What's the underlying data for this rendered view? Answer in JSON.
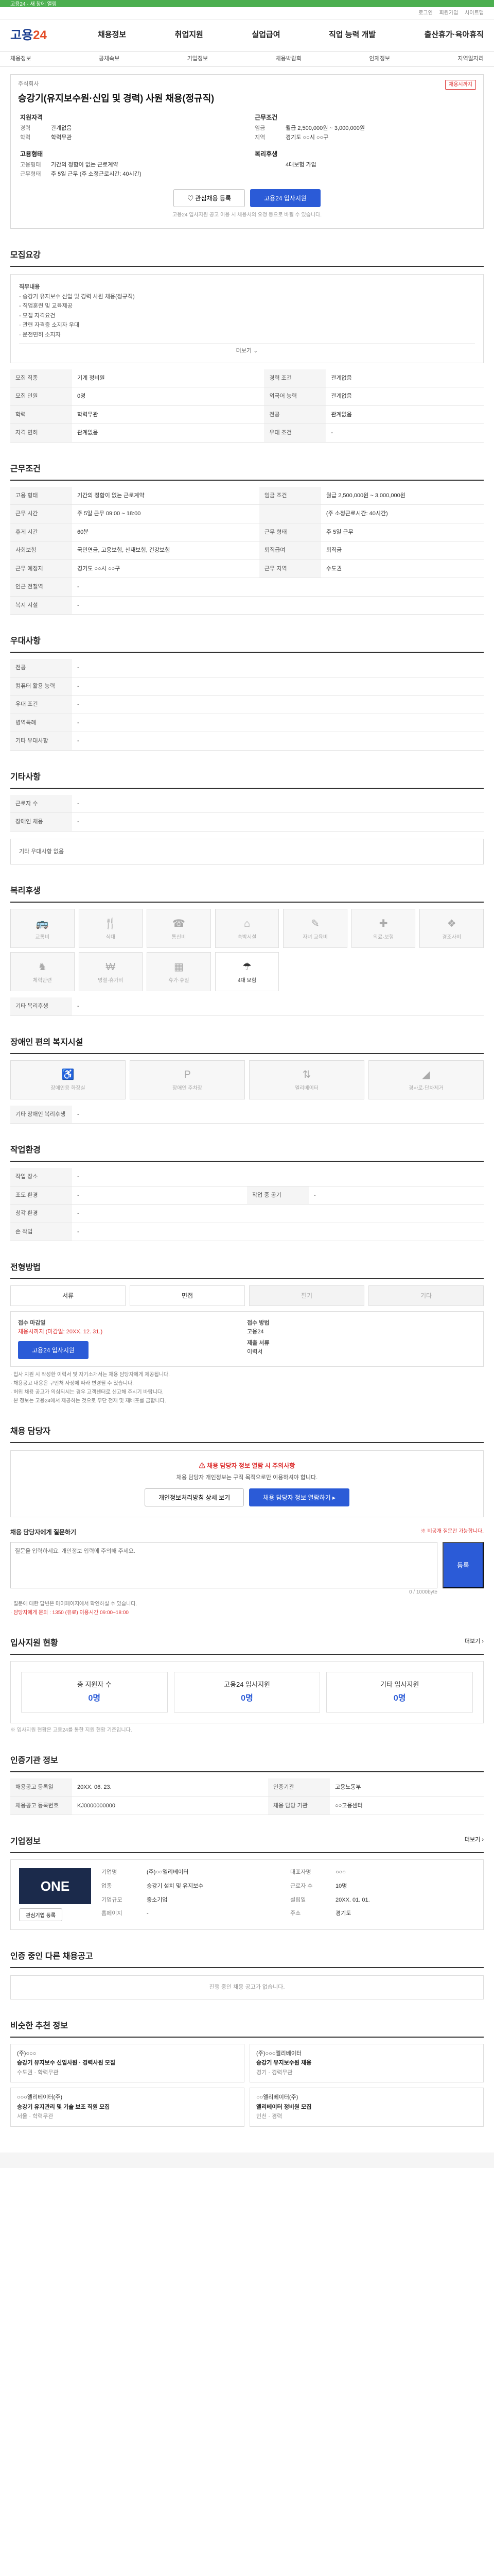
{
  "top": {
    "banner": "고용24 · 새 창에 열림",
    "util": [
      "로그인",
      "회원가입",
      "사이트맵"
    ]
  },
  "header": {
    "logo_a": "고용",
    "logo_b": "24",
    "menu": [
      "채용정보",
      "취업지원",
      "실업급여",
      "직업 능력 개발",
      "출산휴가·육아휴직"
    ]
  },
  "subnav": [
    "채용정보",
    "공채속보",
    "기업정보",
    "채용박람회",
    "인재정보",
    "지역일자리"
  ],
  "job": {
    "company": "주식회사",
    "badge": "채용시까지",
    "title": "승강기(유지보수원·신입 및 경력) 사원 채용(정규직)",
    "left_title": "지원자격",
    "left_rows": [
      [
        "경력",
        "관계없음"
      ],
      [
        "학력",
        "학력무관"
      ]
    ],
    "right_title": "근무조건",
    "right_rows": [
      [
        "임금",
        "월급 2,500,000원 ~ 3,000,000원"
      ],
      [
        "지역",
        "경기도 ○○시 ○○구"
      ]
    ],
    "left2_title": "고용형태",
    "left2_rows": [
      [
        "고용형태",
        "기간의 정함이 없는 근로계약"
      ],
      [
        "근무형태",
        "주 5일 근무 (주 소정근로시간: 40시간)"
      ]
    ],
    "right2_title": "복리후생",
    "right2_rows": [
      [
        "",
        "4대보험 가입"
      ]
    ],
    "btn_scrap": "관심채용 등록",
    "btn_apply": "고용24 입사지원",
    "notice": "고용24 입사지원 공고 이용 시 채용처의 요청 등으로 바뀔 수 있습니다."
  },
  "sec_recruit": {
    "title": "모집요강",
    "box": [
      "직무내용",
      "- 승강기 유지보수 신입 및 경력 사원 채용(정규직)",
      "- 직업훈련 및 교육제공",
      "- 모집 자격요건",
      "  · 관련 자격증 소지자 우대",
      "  · 운전면허 소지자"
    ],
    "more": "더보기 ⌄",
    "rows": [
      [
        "모집 직종",
        "기계 정비원",
        "경력 조건",
        "관계없음"
      ],
      [
        "모집 인원",
        "0명",
        "외국어 능력",
        "관계없음"
      ],
      [
        "학력",
        "학력무관",
        "전공",
        "관계없음"
      ],
      [
        "자격 면허",
        "관계없음",
        "우대 조건",
        "-"
      ]
    ]
  },
  "sec_cond": {
    "title": "근무조건",
    "rows": [
      [
        "고용 형태",
        "기간의 정함이 없는 근로계약",
        "임금 조건",
        "월급 2,500,000원 ~ 3,000,000원"
      ],
      [
        "근무 시간",
        "주 5일 근무 09:00 ~ 18:00",
        "",
        "(주 소정근로시간: 40시간)"
      ],
      [
        "휴게 시간",
        "60분",
        "근무 형태",
        "주 5일 근무"
      ],
      [
        "사회보험",
        "국민연금, 고용보험, 산재보험, 건강보험",
        "퇴직급여",
        "퇴직금"
      ],
      [
        "근무 예정지",
        "경기도 ○○시 ○○구",
        "근무 지역",
        "수도권"
      ],
      [
        "인근 전철역",
        "-",
        "",
        "-"
      ],
      [
        "복지 시설",
        "-",
        "",
        ""
      ]
    ]
  },
  "sec_pref": {
    "title": "우대사항",
    "rows": [
      [
        "전공",
        "-"
      ],
      [
        "컴퓨터 활용 능력",
        "-"
      ],
      [
        "우대 조건",
        "-"
      ],
      [
        "병역특례",
        "-"
      ],
      [
        "기타 우대사항",
        "-"
      ]
    ]
  },
  "sec_etc": {
    "title": "기타사항",
    "rows": [
      [
        "근로자 수",
        "-"
      ],
      [
        "장애인 채용",
        "-"
      ]
    ],
    "box": [
      "기타 우대사항 없음"
    ]
  },
  "sec_welfare": {
    "title": "복리후생",
    "items": [
      "교통비",
      "식대",
      "통신비",
      "숙박시설",
      "자녀 교육비",
      "의료·보험",
      "경조사비",
      "체력단련",
      "명절·휴가비",
      "휴가·휴일",
      "4대 보험"
    ],
    "active": [
      10
    ],
    "other_label": "기타 복리후생",
    "other_val": "-"
  },
  "sec_disab": {
    "title": "장애인 편의 복지시설",
    "items": [
      "장애인용 화장실",
      "장애인 주차장",
      "엘리베이터",
      "경사로·단차제거"
    ],
    "other_label": "기타 장애인 복리후생",
    "other_val": "-"
  },
  "sec_env": {
    "title": "작업환경",
    "rows": [
      [
        "작업 장소",
        "-",
        "",
        ""
      ],
      [
        "조도 환경",
        "-",
        "작업 중 공기",
        "-"
      ],
      [
        "청각 환경",
        "-",
        "",
        ""
      ],
      [
        "손 작업",
        "-",
        "",
        ""
      ]
    ]
  },
  "sec_method": {
    "title": "전형방법",
    "items": [
      "서류",
      "면접",
      "필기",
      "기타"
    ],
    "active": [
      0,
      1
    ],
    "apply_l1": "접수 마감일",
    "apply_l1v": "채용시까지 (마감일: 20XX. 12. 31.)",
    "apply_l2": "접수 방법",
    "apply_l2v": "고용24",
    "apply_l3": "제출 서류",
    "apply_l3v": "이력서",
    "apply_btn": "고용24 입사지원",
    "bullets": [
      "· 입사 지원 시 작성한 이력서 및 자기소개서는 채용 담당자에게 제공됩니다.",
      "· 채용공고 내용은 구인처 사정에 따라 변경될 수 있습니다.",
      "· 허위 채용 공고가 의심되시는 경우 고객센터로 신고해 주시기 바랍니다.",
      "· 본 정보는 고용24에서 제공하는 것으로 무단 전재 및 재배포를 금합니다."
    ]
  },
  "sec_contact": {
    "title": "채용 담당자",
    "warn_title": "채용 담당자 정보 열람 시 주의사항",
    "warn_text": "채용 담당자 개인정보는 구직 목적으로만 이용하셔야 합니다.",
    "btn1": "개인정보처리방침 상세 보기",
    "btn2": "채용 담당자 정보 열람하기 ▸",
    "qna_title": "채용 담당자에게 질문하기",
    "qna_hint": "※ 비공개 질문만 가능합니다.",
    "qna_ph": "질문을 입력하세요. 개인정보 입력에 주의해 주세요.",
    "qna_count": "0 / 1000byte",
    "qna_btn": "등록",
    "qna_notes": [
      "· 질문에 대한 답변은 마이페이지에서 확인하실 수 있습니다.",
      "· 담당자에게 문의 : 1350 (유료) 이용시간 09:00~18:00"
    ]
  },
  "sec_stats": {
    "title": "입사지원 현황",
    "link": "더보기 ›",
    "items": [
      [
        "총 지원자 수",
        "0명"
      ],
      [
        "고용24 입사지원",
        "0명"
      ],
      [
        "기타 입사지원",
        "0명"
      ]
    ],
    "note": "※ 입사지원 현황은 고용24를 통한 지원 현황 기준입니다."
  },
  "sec_agency": {
    "title": "인증기관 정보",
    "rows": [
      [
        "채용공고 등록일",
        "20XX. 06. 23.",
        "인증기관",
        "고용노동부"
      ],
      [
        "채용공고 등록번호",
        "KJ0000000000",
        "채용 담당 기관",
        "○○고용센터"
      ]
    ]
  },
  "sec_company": {
    "title": "기업정보",
    "link": "더보기 ›",
    "logo": "ONE",
    "rows": [
      [
        "기업명",
        "(주)○○엘리베이터",
        "대표자명",
        "○○○"
      ],
      [
        "업종",
        "승강기 설치 및 유지보수",
        "근로자 수",
        "10명"
      ],
      [
        "기업규모",
        "중소기업",
        "설립일",
        "20XX. 01. 01."
      ],
      [
        "홈페이지",
        "-",
        "주소",
        "경기도"
      ]
    ],
    "btn": "관심기업 등록"
  },
  "sec_recent": {
    "title": "인증 중인 다른 채용공고",
    "empty": "진행 중인 채용 공고가 없습니다."
  },
  "sec_reco": {
    "title": "비슷한 추천 정보",
    "items": [
      [
        "(주)○○○",
        "승강기 유지보수 신입사원 · 경력사원 모집",
        "수도권 · 학력무관"
      ],
      [
        "(주)○○○엘리베이터",
        "승강기 유지보수원 채용",
        "경기 · 경력무관"
      ],
      [
        "○○○엘리베이터(주)",
        "승강기 유지관리 및 기술 보조 직원 모집",
        "서울 · 학력무관"
      ],
      [
        "○○엘리베이터(주)",
        "엘리베이터 정비원 모집",
        "인천 · 경력"
      ]
    ]
  }
}
